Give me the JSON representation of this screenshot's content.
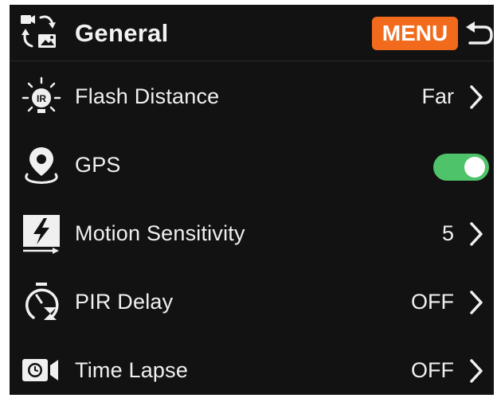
{
  "header": {
    "title": "General",
    "menu_label": "MENU",
    "icons": {
      "section": "camera-photo-switch-icon",
      "back": "back-arrow-icon"
    }
  },
  "settings": [
    {
      "label": "Flash Distance",
      "value": "Far",
      "icon": "ir-flash-icon",
      "control": "chevron"
    },
    {
      "label": "GPS",
      "value": "on",
      "icon": "gps-location-icon",
      "control": "toggle"
    },
    {
      "label": "Motion Sensitivity",
      "value": "5",
      "icon": "motion-sensitivity-icon",
      "control": "chevron"
    },
    {
      "label": "PIR Delay",
      "value": "OFF",
      "icon": "timer-hourglass-icon",
      "control": "chevron"
    },
    {
      "label": "Time Lapse",
      "value": "OFF",
      "icon": "time-lapse-camera-icon",
      "control": "chevron"
    }
  ],
  "colors": {
    "background": "#121212",
    "menu_badge": "#f26b1d",
    "toggle_on": "#4fc36a",
    "text": "#f0f0f0"
  }
}
